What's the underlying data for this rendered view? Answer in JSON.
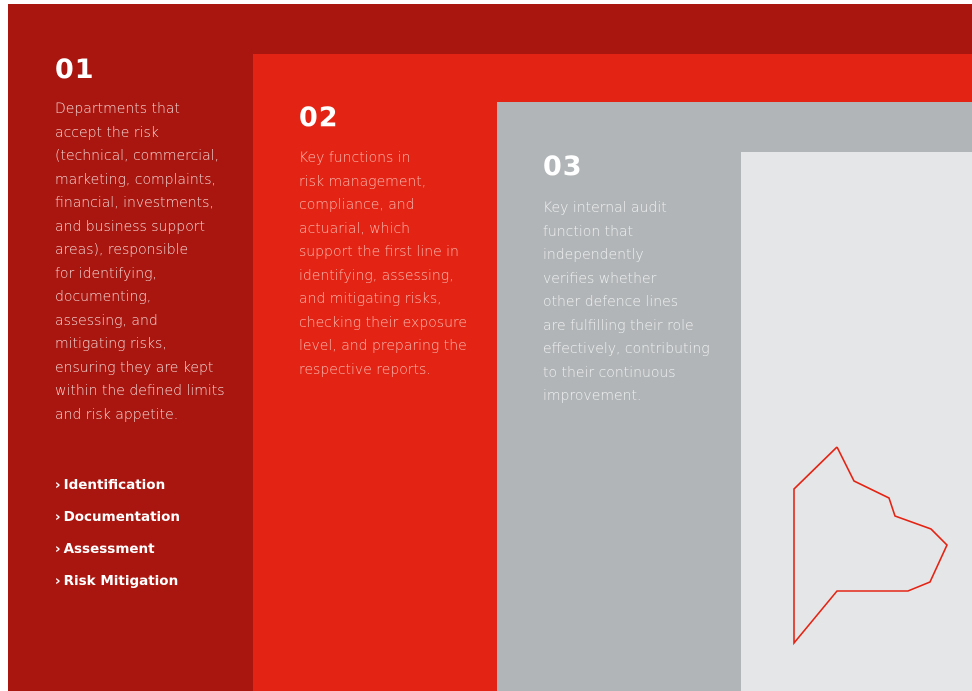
{
  "lines": [
    {
      "number": "01",
      "description": "Departments that\naccept the risk\n(technical, commercial,\nmarketing, complaints,\nfinancial, investments,\nand business support\nareas), responsible\nfor identifying,\ndocumenting,\nassessing, and\nmitigating risks,\nensuring they are kept\nwithin the defined limits\nand risk appetite.",
      "steps": [
        "Identification",
        "Documentation",
        "Assessment",
        "Risk Mitigation"
      ]
    },
    {
      "number": "02",
      "description": "Key functions in\nrisk management,\ncompliance, and\nactuarial, which\nsupport the first line in\nidentifying, assessing,\nand mitigating risks,\nchecking their exposure\nlevel, and preparing the\nrespective reports."
    },
    {
      "number": "03",
      "description": "Key internal audit\nfunction that\nindependently\nverifies whether\nother defence lines\nare fulfilling their role\neffectively, contributing\nto their continuous\nimprovement."
    }
  ],
  "step_marker": "›",
  "colors": {
    "line1_bg": "#a9150f",
    "line2_bg": "#e32414",
    "line3_bg": "#b2b5b7",
    "line4_bg": "#e5e6e7",
    "outline_stroke": "#e32414"
  },
  "decoration": {
    "outline_shape": "red-outline-map-icon"
  }
}
